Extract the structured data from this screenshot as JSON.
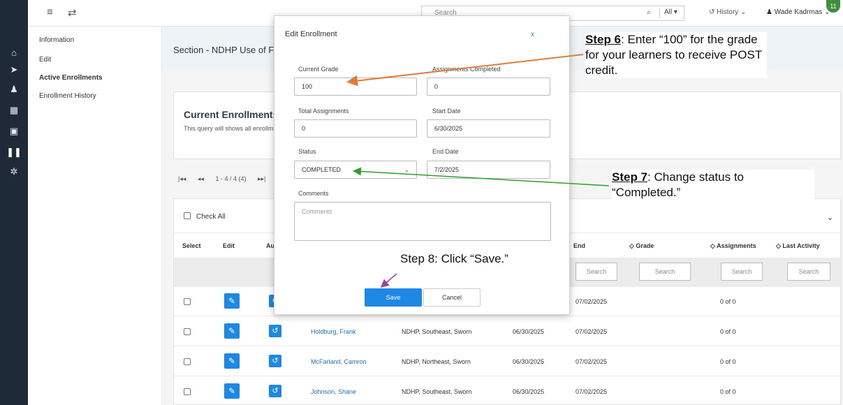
{
  "rail": {
    "icons": [
      "home-icon",
      "send-icon",
      "person-icon",
      "calendar-icon",
      "save-icon",
      "library-icon",
      "gear-icon"
    ]
  },
  "topbar": {
    "search_placeholder": "Search",
    "all_label": "All ▾",
    "history_label": "History ⌄",
    "user_name": "Wade Kadrmas ⌄",
    "user_badge": "11"
  },
  "subnav": {
    "items": [
      {
        "label": "Information"
      },
      {
        "label": "Edit"
      },
      {
        "label": "Active Enrollments"
      },
      {
        "label": "Enrollment History"
      }
    ]
  },
  "section": {
    "title": "Section - NDHP Use of For"
  },
  "enrollments": {
    "title": "Current Enrollments:",
    "description": "This query will shows all enrollm"
  },
  "pager": {
    "first": "|◂◂",
    "prev": "◂◂",
    "range": "1 - 4 / 4 (4)",
    "next": "▸▸|"
  },
  "table": {
    "check_all": "Check All",
    "headers": {
      "select": "Select",
      "edit": "Edit",
      "audit": "Au",
      "end": "End",
      "grade": "◇ Grade",
      "assignments": "◇ Assignments",
      "last_activity": "◇ Last Activity"
    },
    "filter_placeholder": "Search",
    "rows": [
      {
        "name": "",
        "section": "",
        "start": "",
        "end": "07/02/2025",
        "assignments": "0 of 0"
      },
      {
        "name": "Holdburg, Frank",
        "section": "NDHP, Southeast, Sworn",
        "start": "06/30/2025",
        "end": "07/02/2025",
        "assignments": "0 of 0"
      },
      {
        "name": "McFarland, Camron",
        "section": "NDHP, Northeast, Sworn",
        "start": "06/30/2025",
        "end": "07/02/2025",
        "assignments": "0 of 0"
      },
      {
        "name": "Johnson, Shane",
        "section": "NDHP, Southeast, Sworn",
        "start": "06/30/2025",
        "end": "07/02/2025",
        "assignments": "0 of 0"
      }
    ]
  },
  "modal": {
    "title": "Edit Enrollment",
    "close": "x",
    "current_grade_label": "Current Grade",
    "current_grade_value": "100",
    "assignments_completed_label": "Assignments Completed",
    "assignments_completed_value": "0",
    "total_assignments_label": "Total Assignments",
    "total_assignments_value": "0",
    "start_date_label": "Start Date",
    "start_date_value": "6/30/2025",
    "status_label": "Status",
    "status_value": "COMPLETED",
    "end_date_label": "End Date",
    "end_date_value": "7/2/2025",
    "comments_label": "Comments",
    "comments_placeholder": "Comments",
    "save_label": "Save",
    "cancel_label": "Cancel"
  },
  "annotations": {
    "step6_bold": "Step 6",
    "step6_text": ": Enter “100” for the grade for your learners to receive POST credit.",
    "step7_bold": "Step 7",
    "step7_text": ": Change status to “Completed.”",
    "step8_text": "Step 8: Click “Save.”",
    "colors": {
      "step6_arrow": "#e07b39",
      "step7_arrow": "#2e9e2e",
      "step8_arrow": "#a040b0",
      "primary": "#1e88e5"
    }
  }
}
